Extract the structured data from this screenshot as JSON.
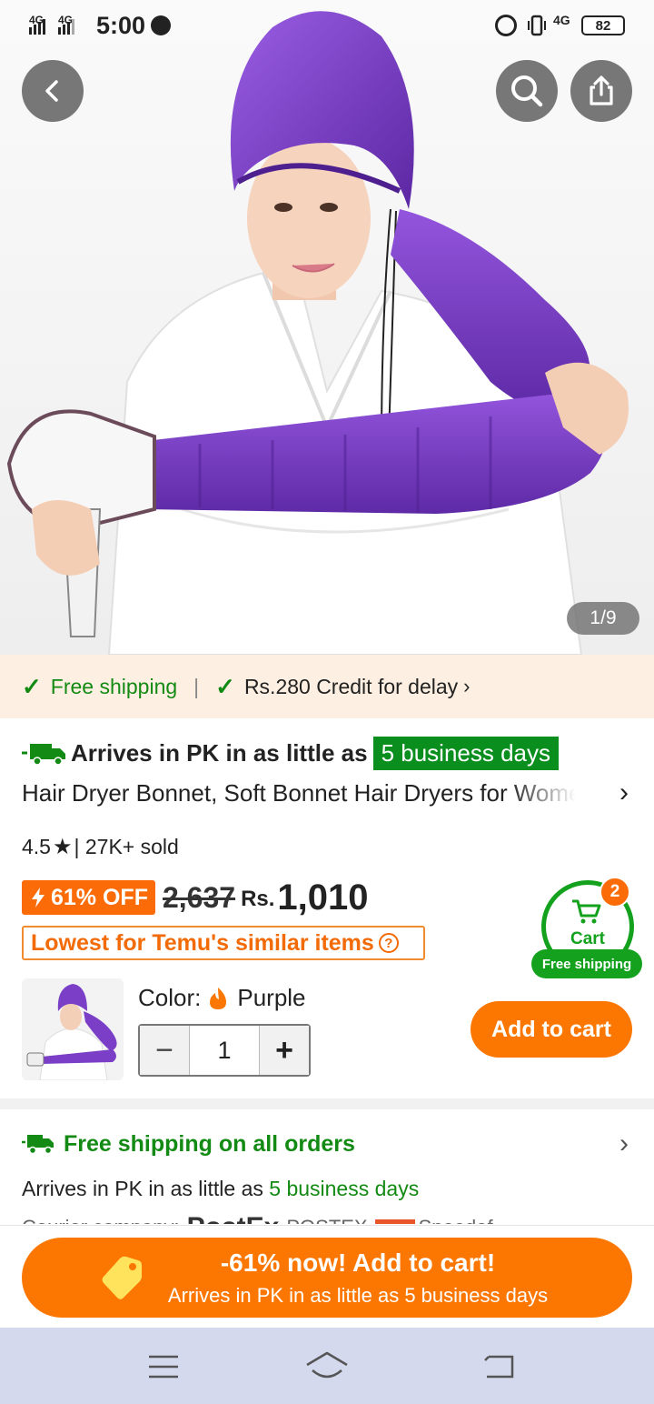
{
  "status_bar": {
    "time": "5:00",
    "network_left_1": "4G",
    "network_left_2": "4G",
    "network_right": "4G",
    "battery": "82"
  },
  "gallery": {
    "counter": "1/9",
    "colors": {
      "bonnet": "#7a3fc6",
      "robe": "#ffffff"
    }
  },
  "shipping_strip": {
    "free_shipping": "Free shipping",
    "credit": "Rs.280 Credit for delay",
    "divider": "|"
  },
  "arrival": {
    "prefix": "Arrives in PK in as little as",
    "days": "5 business days"
  },
  "product": {
    "title": "Hair Dryer Bonnet, Soft Bonnet Hair Dryers for Women",
    "rating": "4.5",
    "sold": "| 27K+ sold"
  },
  "price": {
    "discount": "61% OFF",
    "original": "2,637",
    "currency": "Rs.",
    "current": "1,010"
  },
  "lowest_badge": "Lowest for Temu's similar items",
  "cart_widget": {
    "count": "2",
    "label": "Cart",
    "shipping": "Free shipping"
  },
  "variant": {
    "color_label": "Color:",
    "color_value": "Purple",
    "quantity": "1",
    "minus": "−",
    "plus": "+"
  },
  "add_to_cart": "Add to cart",
  "free_shipping_section": {
    "title": "Free shipping on all orders",
    "arrive_prefix": "Arrives in PK in as little as",
    "arrive_days": "5 business days",
    "courier_label": "Courier company:",
    "courier_1": "PostEx",
    "courier_2": "POSTEX",
    "courier_3": "Speedaf"
  },
  "cta": {
    "title": "-61% now! Add to cart!",
    "subtitle": "Arrives in PK in as little as 5 business days"
  },
  "theme": {
    "orange": "#fb7701",
    "green": "#138a13",
    "nav_bg": "#d4d9ee"
  }
}
